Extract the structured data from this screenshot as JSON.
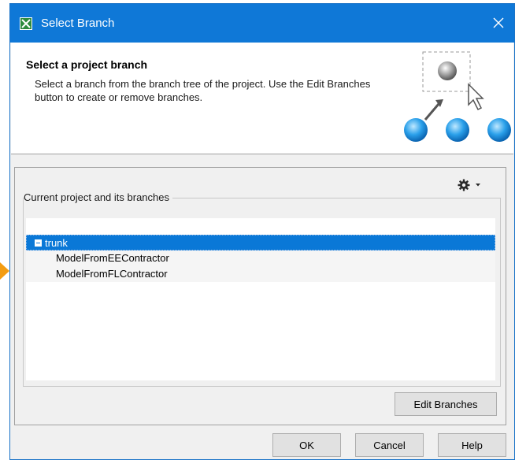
{
  "window": {
    "title": "Select Branch"
  },
  "header": {
    "title": "Select a project branch",
    "description": "Select a branch from the branch tree of the project. Use the Edit Branches button to create or remove branches."
  },
  "content": {
    "group_label": "Current project and its branches",
    "tree": [
      {
        "label": "trunk",
        "level": 0,
        "expanded": true,
        "selected": true
      },
      {
        "label": "ModelFromEEContractor",
        "level": 1
      },
      {
        "label": "ModelFromFLContractor",
        "level": 1
      }
    ],
    "edit_branches_label": "Edit Branches"
  },
  "footer": {
    "ok_label": "OK",
    "cancel_label": "Cancel",
    "help_label": "Help"
  },
  "icons": {
    "app": "magicdraw-app-icon",
    "close": "close-icon",
    "settings": "gear-icon",
    "dropdown": "chevron-down-icon"
  },
  "colors": {
    "title_bar": "#0f78d7",
    "selection": "#0a78d7",
    "accent_marker": "#f39c12"
  }
}
